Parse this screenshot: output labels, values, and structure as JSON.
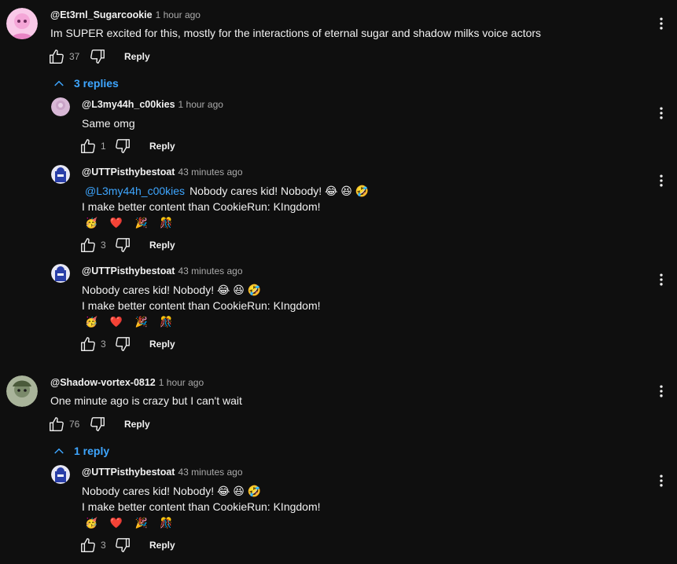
{
  "threads": [
    {
      "author": "@Et3rnl_Sugarcookie",
      "time": "1 hour ago",
      "text": "Im SUPER excited for this, mostly for the interactions of eternal sugar and shadow milks voice actors",
      "likes": "37",
      "reply_label": "Reply",
      "avatar_color": "#f4a6d7",
      "replies_label": "3 replies",
      "replies": [
        {
          "author": "@L3my44h_c00kies",
          "time": "1 hour ago",
          "lines": [
            "Same omg"
          ],
          "likes": "1",
          "reply_label": "Reply",
          "avatar_color": "#c9a3c7"
        },
        {
          "author": "@UTTPisthybestoat",
          "time": "43 minutes ago",
          "mention": "@L3my44h_c00kies",
          "lines": [
            "Nobody cares kid! Nobody! 😂 😆 🤣",
            "I make better content than CookieRun: KIngdom!"
          ],
          "emojis": "🥳 ❤️ 🎉 🎊",
          "likes": "3",
          "reply_label": "Reply",
          "avatar_color": "#2a3fa8"
        },
        {
          "author": "@UTTPisthybestoat",
          "time": "43 minutes ago",
          "lines": [
            "Nobody cares kid! Nobody! 😂 😆 🤣",
            "I make better content than CookieRun: KIngdom!"
          ],
          "emojis": "🥳 ❤️ 🎉 🎊",
          "likes": "3",
          "reply_label": "Reply",
          "avatar_color": "#2a3fa8"
        }
      ]
    },
    {
      "author": "@Shadow-vortex-0812",
      "time": "1 hour ago",
      "text": "One minute ago is crazy but I can't wait",
      "likes": "76",
      "reply_label": "Reply",
      "avatar_color": "#7a8a6a",
      "replies_label": "1 reply",
      "replies": [
        {
          "author": "@UTTPisthybestoat",
          "time": "43 minutes ago",
          "lines": [
            "Nobody cares kid! Nobody! 😂 😆 🤣",
            "I make better content than CookieRun: KIngdom!"
          ],
          "emojis": "🥳 ❤️ 🎉 🎊",
          "likes": "3",
          "reply_label": "Reply",
          "avatar_color": "#2a3fa8"
        }
      ]
    }
  ]
}
